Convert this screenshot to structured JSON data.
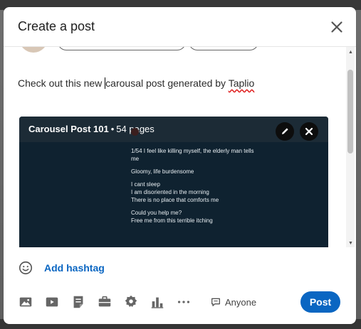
{
  "modal": {
    "title": "Create a post",
    "close_icon": "close-icon"
  },
  "composer": {
    "text_before_caret": "Check out this new ",
    "text_after_caret": "carousal post generated by ",
    "misspelled_word": "Taplio"
  },
  "carousel": {
    "title": "Carousel Post 101",
    "separator": "•",
    "pages": "54 pages",
    "edit_icon": "pencil-icon",
    "remove_icon": "close-icon",
    "slide_lines": [
      "1/54 I feel like killing myself, the elderly man tells me",
      "Gloomy, life burdensome",
      "I cant sleep\nI am disoriented in the morning\nThere is no place that comforts me",
      "Could you help me?\nFree me from this terrible itching"
    ]
  },
  "hashtag": {
    "emoji_icon": "smiley-icon",
    "label": "Add hashtag"
  },
  "toolbar": {
    "icons": [
      "image-icon",
      "video-icon",
      "document-icon",
      "job-icon",
      "badge-icon",
      "chart-icon",
      "more-icon"
    ],
    "audience_icon": "comment-icon",
    "audience_label": "Anyone",
    "post_label": "Post"
  },
  "colors": {
    "accent": "#0a66c2",
    "carousel_bg": "#0f2230"
  }
}
